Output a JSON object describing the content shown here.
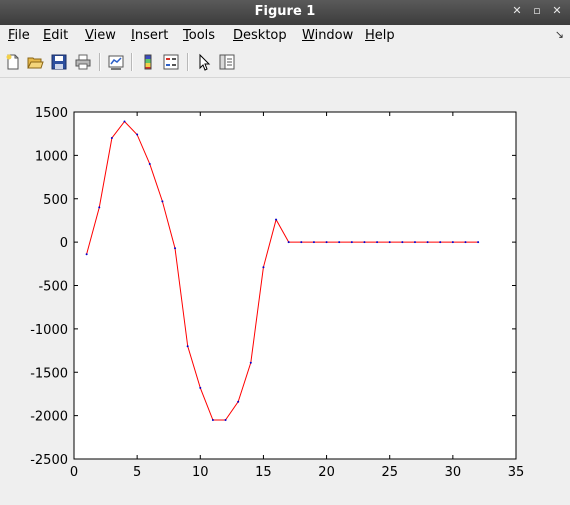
{
  "window": {
    "title": "Figure 1",
    "minimize_glyph": "✕",
    "controls": [
      "✕",
      "▫",
      "✕"
    ]
  },
  "menubar": {
    "items": [
      {
        "label": "File",
        "mnemonic": "F"
      },
      {
        "label": "Edit",
        "mnemonic": "E"
      },
      {
        "label": "View",
        "mnemonic": "V"
      },
      {
        "label": "Insert",
        "mnemonic": "I"
      },
      {
        "label": "Tools",
        "mnemonic": "T"
      },
      {
        "label": "Desktop",
        "mnemonic": "D"
      },
      {
        "label": "Window",
        "mnemonic": "W"
      },
      {
        "label": "Help",
        "mnemonic": "H"
      }
    ],
    "dock_glyph": "↘"
  },
  "toolbar": {
    "icons": [
      "new-figure-icon",
      "open-file-icon",
      "save-icon",
      "print-icon",
      "link-plot-icon",
      "colorbar-icon",
      "legend-icon",
      "pointer-icon",
      "property-editor-icon"
    ]
  },
  "chart_data": {
    "type": "line",
    "x": [
      1,
      2,
      3,
      4,
      5,
      6,
      7,
      8,
      9,
      10,
      11,
      12,
      13,
      14,
      15,
      16,
      17,
      18,
      19,
      20,
      21,
      22,
      23,
      24,
      25,
      26,
      27,
      28,
      29,
      30,
      31,
      32
    ],
    "series": [
      {
        "values": [
          -140,
          400,
          1200,
          1390,
          1240,
          900,
          470,
          -70,
          -1200,
          -1680,
          -2050,
          -2050,
          -1840,
          -1390,
          -290,
          260,
          0,
          0,
          0,
          0,
          0,
          0,
          0,
          0,
          0,
          0,
          0,
          0,
          0,
          0,
          0,
          0
        ],
        "color": "#ff0000",
        "marker_color": "#0000cc"
      }
    ],
    "xlim": [
      0,
      35
    ],
    "ylim": [
      -2500,
      1500
    ],
    "xticks": [
      0,
      5,
      10,
      15,
      20,
      25,
      30,
      35
    ],
    "yticks": [
      1500,
      1000,
      500,
      0,
      -500,
      -1000,
      -1500,
      -2000,
      -2500
    ],
    "xtick_labels": [
      "0",
      "5",
      "10",
      "15",
      "20",
      "25",
      "30",
      "35"
    ],
    "ytick_labels": [
      "1500",
      "1000",
      "500",
      "0",
      "-500",
      "-1000",
      "-1500",
      "-2000",
      "-2500"
    ],
    "grid": false
  }
}
